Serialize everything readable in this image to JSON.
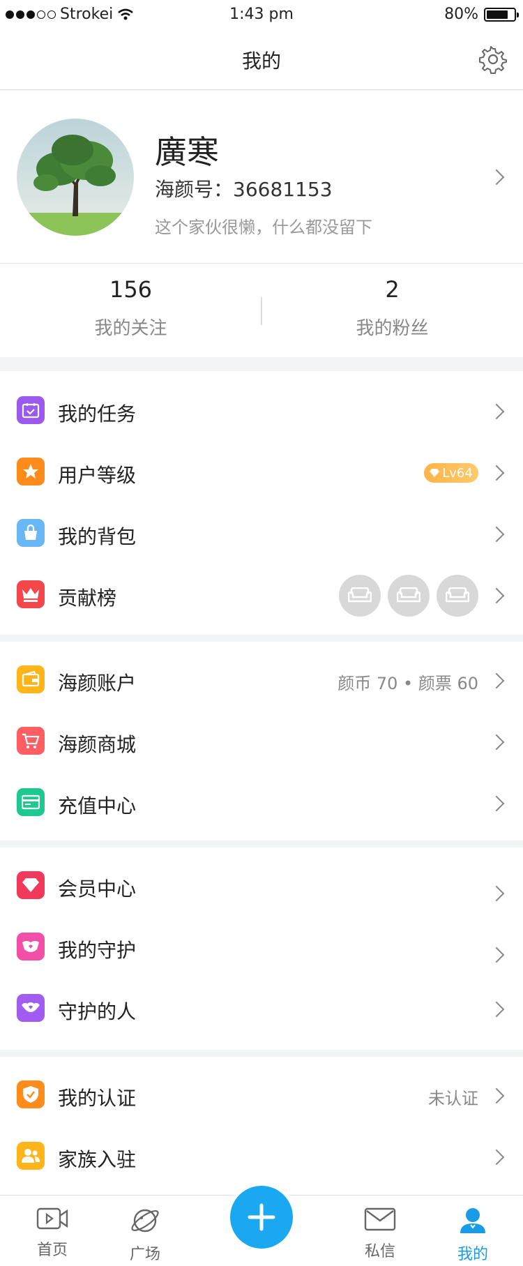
{
  "status": {
    "carrier": "Strokei",
    "time": "1:43 pm",
    "battery": "80%",
    "battery_level": 0.8
  },
  "nav": {
    "title": "我的"
  },
  "profile": {
    "name": "廣寒",
    "id_label": "海颜号：",
    "id_value": "36681153",
    "bio": "这个家伙很懒，什么都没留下"
  },
  "stats": [
    {
      "value": "156",
      "label": "我的关注"
    },
    {
      "value": "2",
      "label": "我的粉丝"
    }
  ],
  "colors": {
    "accent": "#1a9be6",
    "tasks": "#9b59f0",
    "level": "#ff8c1a",
    "backpack": "#6ab7f5",
    "ranking": "#f5474a",
    "account": "#ffb51a",
    "mall": "#ff5e62",
    "recharge": "#1dc98e",
    "member": "#f2385b",
    "guard": "#f24fa6",
    "guarded": "#a35cf2",
    "cert": "#ff8c1a",
    "family": "#ffb51a"
  },
  "group1": [
    {
      "label": "我的任务",
      "icon": "calendar-icon"
    },
    {
      "label": "用户等级",
      "icon": "star-icon",
      "badge": "Lv64"
    },
    {
      "label": "我的背包",
      "icon": "bag-icon"
    },
    {
      "label": "贡献榜",
      "icon": "crown-icon"
    }
  ],
  "group2": [
    {
      "label": "海颜账户",
      "icon": "wallet-icon",
      "right": "颜币 70 • 颜票 60"
    },
    {
      "label": "海颜商城",
      "icon": "cart-icon"
    },
    {
      "label": "充值中心",
      "icon": "card-icon"
    }
  ],
  "group3": [
    {
      "label": "会员中心",
      "icon": "diamond-icon"
    },
    {
      "label": "我的守护",
      "icon": "guard-icon"
    },
    {
      "label": "守护的人",
      "icon": "guarded-icon"
    }
  ],
  "group4": [
    {
      "label": "我的认证",
      "icon": "shield-icon",
      "right": "未认证"
    },
    {
      "label": "家族入驻",
      "icon": "family-icon"
    }
  ],
  "tabs": [
    {
      "label": "首页",
      "icon": "video-icon"
    },
    {
      "label": "广场",
      "icon": "planet-icon"
    },
    {
      "label": "私信",
      "icon": "mail-icon"
    },
    {
      "label": "我的",
      "icon": "user-icon",
      "active": true
    }
  ]
}
